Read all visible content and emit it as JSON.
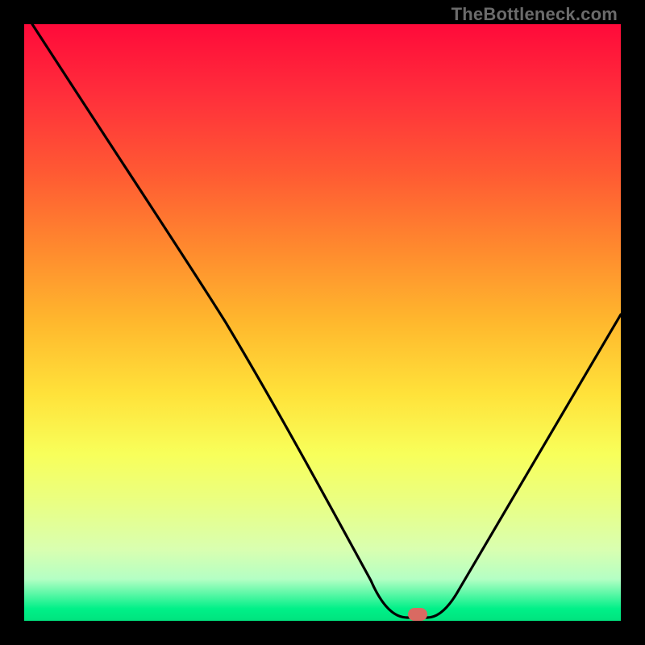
{
  "watermark": "TheBottleneck.com",
  "chart_data": {
    "type": "line",
    "title": "",
    "xlabel": "",
    "ylabel": "",
    "xlim": [
      0,
      100
    ],
    "ylim": [
      0,
      100
    ],
    "x": [
      0,
      5,
      10,
      15,
      20,
      25,
      30,
      35,
      40,
      45,
      50,
      53,
      56,
      59,
      62,
      65,
      68,
      71,
      74,
      77,
      80,
      83,
      86,
      89,
      92,
      95,
      98,
      100
    ],
    "values": [
      100,
      92,
      84,
      76,
      69,
      62,
      56,
      49,
      42,
      35,
      28,
      23,
      18,
      13,
      8,
      4,
      1,
      0,
      5,
      10,
      15,
      20,
      25,
      30,
      35,
      40,
      45,
      49
    ],
    "marker": {
      "x": 71,
      "y": 0
    },
    "gradient_stops": [
      {
        "pos": 0,
        "color": "#ff0a3a"
      },
      {
        "pos": 12,
        "color": "#ff2f3b"
      },
      {
        "pos": 25,
        "color": "#ff5a33"
      },
      {
        "pos": 38,
        "color": "#ff8b2e"
      },
      {
        "pos": 50,
        "color": "#ffb82d"
      },
      {
        "pos": 62,
        "color": "#ffe23a"
      },
      {
        "pos": 72,
        "color": "#f8ff5a"
      },
      {
        "pos": 80,
        "color": "#eaff82"
      },
      {
        "pos": 88,
        "color": "#d9ffb0"
      },
      {
        "pos": 93,
        "color": "#b4ffc4"
      },
      {
        "pos": 98,
        "color": "#00f088"
      },
      {
        "pos": 100,
        "color": "#00e37e"
      }
    ]
  }
}
